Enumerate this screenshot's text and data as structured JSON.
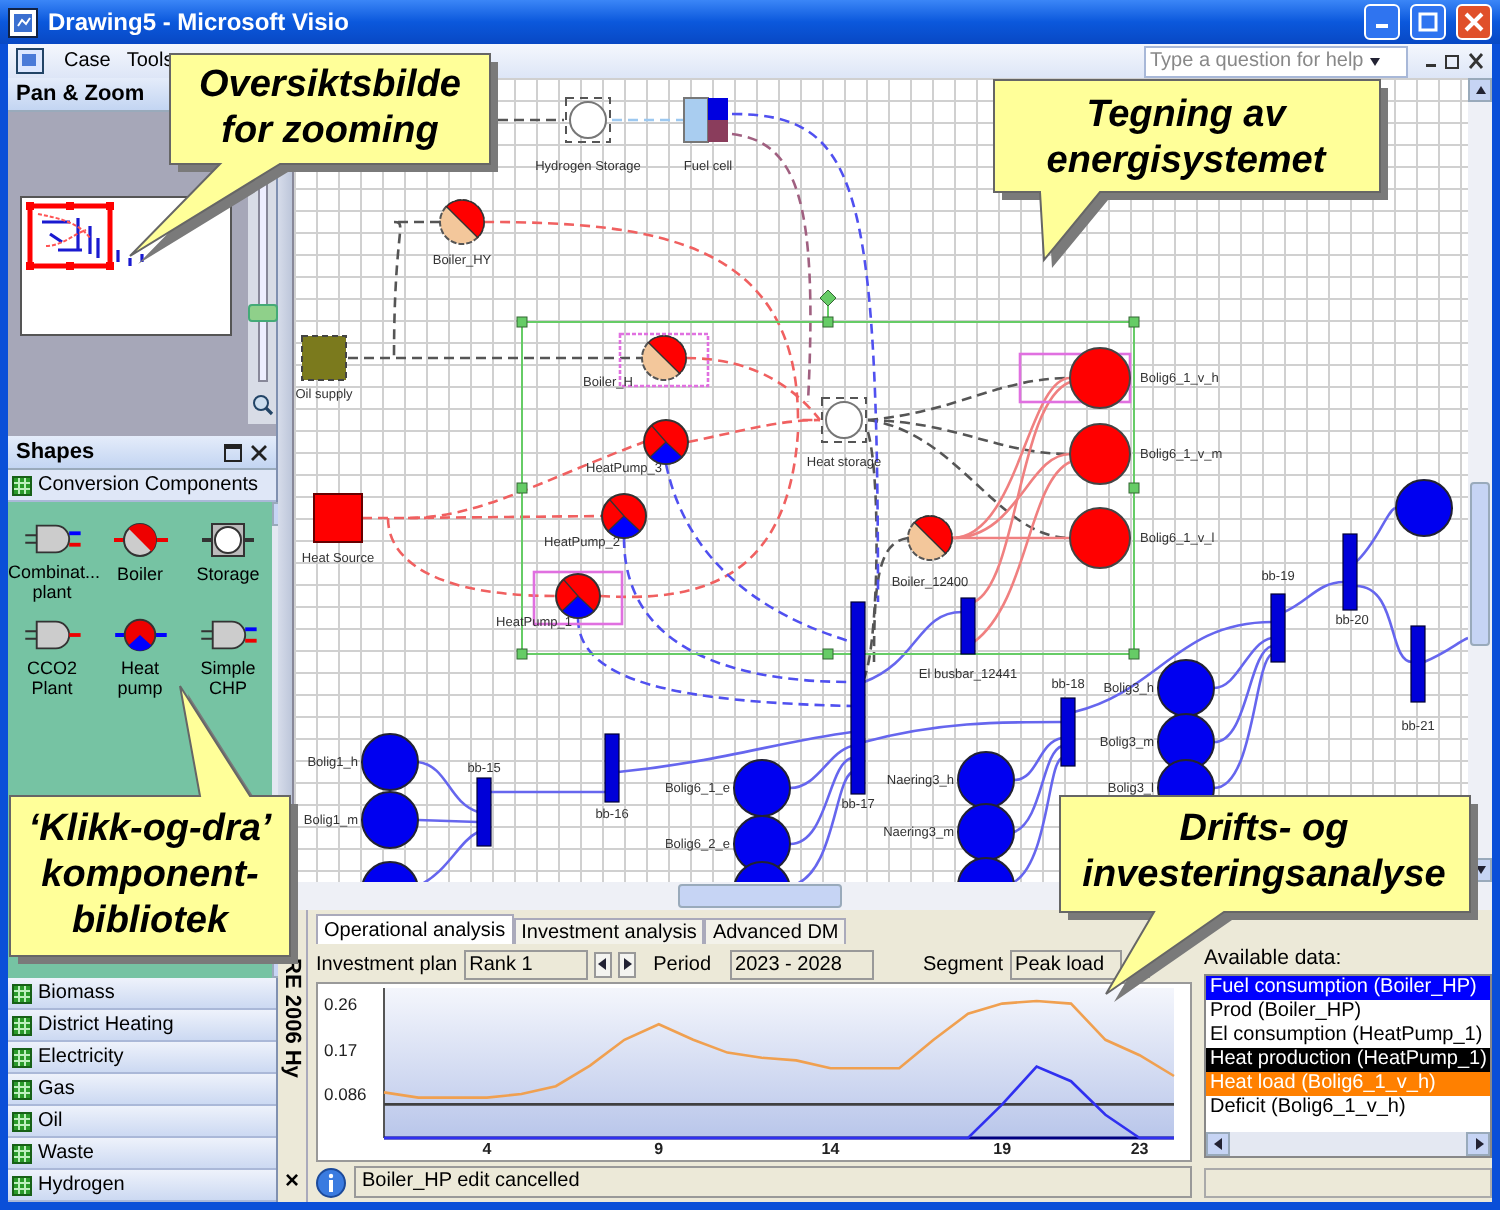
{
  "window": {
    "title": "Drawing5 - Microsoft Visio"
  },
  "menu": {
    "items": [
      "Case",
      "Tools"
    ],
    "help_search": {
      "placeholder": "Type a question for help"
    }
  },
  "pan_zoom": {
    "title": "Pan & Zoom",
    "zoom": {
      "level": 0.27
    }
  },
  "shapes": {
    "title": "Shapes",
    "stencils": [
      {
        "label": "Conversion Components",
        "expanded": true,
        "shapes": [
          {
            "label": "Combinat... plant",
            "kind": "chp"
          },
          {
            "label": "Boiler",
            "kind": "boiler"
          },
          {
            "label": "Storage",
            "kind": "storage"
          },
          {
            "label": "CCO2 Plant",
            "kind": "cco2"
          },
          {
            "label": "Heat pump",
            "kind": "heat-pump"
          },
          {
            "label": "Simple CHP",
            "kind": "chp"
          }
        ]
      },
      {
        "label": "Biomass",
        "expanded": false
      },
      {
        "label": "District Heating",
        "expanded": false
      },
      {
        "label": "Electricity",
        "expanded": false
      },
      {
        "label": "Gas",
        "expanded": false
      },
      {
        "label": "Oil",
        "expanded": false
      },
      {
        "label": "Waste",
        "expanded": false
      },
      {
        "label": "Hydrogen",
        "expanded": false
      }
    ]
  },
  "side_strip": {
    "label": "RE 2006 Hy",
    "close": "×"
  },
  "diagram": {
    "nodes": [
      {
        "label": "Hydrogen Storage",
        "kind": "storage",
        "highlighted": false
      },
      {
        "label": "Fuel cell",
        "kind": "fuel-cell",
        "highlighted": false
      },
      {
        "label": "Boiler_HY",
        "kind": "boiler",
        "highlighted": false
      },
      {
        "label": "Oil supply",
        "kind": "oil-supply",
        "highlighted": false
      },
      {
        "label": "Boiler_H",
        "kind": "boiler",
        "highlighted": true
      },
      {
        "label": "Heat storage",
        "kind": "storage",
        "highlighted": false
      },
      {
        "label": "HeatPump_3",
        "kind": "heat-pump",
        "highlighted": false
      },
      {
        "label": "HeatPump_2",
        "kind": "heat-pump",
        "highlighted": false
      },
      {
        "label": "Heat Source",
        "kind": "heat-source",
        "highlighted": false
      },
      {
        "label": "HeatPump_1",
        "kind": "heat-pump",
        "highlighted": true
      },
      {
        "label": "Bolig6_1_v_h",
        "kind": "heat-demand",
        "highlighted": true
      },
      {
        "label": "Bolig6_1_v_m",
        "kind": "heat-demand",
        "highlighted": false
      },
      {
        "label": "Bolig6_1_v_l",
        "kind": "heat-demand",
        "highlighted": false
      },
      {
        "label": "Boiler_12400",
        "kind": "boiler",
        "highlighted": false
      },
      {
        "label": "El busbar_12441",
        "kind": "busbar",
        "highlighted": false
      },
      {
        "label": "bb-17",
        "kind": "busbar",
        "highlighted": false
      },
      {
        "label": "bb-19",
        "kind": "busbar",
        "highlighted": false
      },
      {
        "label": "bb-20",
        "kind": "busbar",
        "highlighted": false
      },
      {
        "label": "bb-21",
        "kind": "busbar",
        "highlighted": false
      },
      {
        "label": "bb-18",
        "kind": "busbar",
        "highlighted": false
      },
      {
        "label": "bb-15",
        "kind": "busbar",
        "highlighted": false
      },
      {
        "label": "bb-16",
        "kind": "busbar",
        "highlighted": false
      },
      {
        "label": "Bolig1_h",
        "kind": "el-demand",
        "highlighted": false
      },
      {
        "label": "Bolig1_m",
        "kind": "el-demand",
        "highlighted": false
      },
      {
        "kind": "el-demand",
        "highlighted": false
      },
      {
        "label": "Bolig6_1_e",
        "kind": "el-demand",
        "highlighted": false
      },
      {
        "label": "Bolig6_2_e",
        "kind": "el-demand",
        "highlighted": false
      },
      {
        "kind": "el-demand",
        "highlighted": false
      },
      {
        "label": "Naering3_h",
        "kind": "el-demand",
        "highlighted": false
      },
      {
        "label": "Naering3_m",
        "kind": "el-demand",
        "highlighted": false
      },
      {
        "kind": "el-demand",
        "highlighted": false
      },
      {
        "label": "Bolig3_h",
        "kind": "el-demand",
        "highlighted": false
      },
      {
        "label": "Bolig3_m",
        "kind": "el-demand",
        "highlighted": false
      },
      {
        "label": "Bolig3_l",
        "kind": "el-demand",
        "highlighted": false
      },
      {
        "kind": "el-demand",
        "highlighted": false
      }
    ]
  },
  "analysis": {
    "tabs": [
      {
        "label": "Operational analysis",
        "selected": true
      },
      {
        "label": "Investment analysis",
        "selected": false
      },
      {
        "label": "Advanced DM",
        "selected": false
      }
    ],
    "investment_plan": {
      "label": "Investment plan",
      "value": "Rank 1"
    },
    "period": {
      "label": "Period",
      "value": "2023 - 2028"
    },
    "segment": {
      "label": "Segment",
      "value": "Peak load"
    },
    "chart_data": {
      "type": "line",
      "x": [
        1,
        2,
        3,
        4,
        5,
        6,
        7,
        8,
        9,
        10,
        11,
        12,
        13,
        14,
        15,
        16,
        17,
        18,
        19,
        20,
        21,
        22,
        23,
        24
      ],
      "xlim": [
        1,
        24
      ],
      "ylim": [
        0,
        0.29
      ],
      "xticks": [
        4,
        9,
        14,
        19,
        23
      ],
      "yticks": [
        0.086,
        0.17,
        0.26
      ],
      "series": [
        {
          "color": "#f0a050",
          "values": [
            0.088,
            0.078,
            0.078,
            0.078,
            0.085,
            0.1,
            0.14,
            0.19,
            0.22,
            0.19,
            0.165,
            0.155,
            0.15,
            0.135,
            0.135,
            0.135,
            0.19,
            0.24,
            0.26,
            0.265,
            0.26,
            0.19,
            0.16,
            0.12
          ]
        },
        {
          "color": "#404040",
          "values": [
            0.065,
            0.065,
            0.065,
            0.065,
            0.065,
            0.065,
            0.065,
            0.065,
            0.065,
            0.065,
            0.065,
            0.065,
            0.065,
            0.065,
            0.065,
            0.065,
            0.065,
            0.065,
            0.065,
            0.065,
            0.065,
            0.065,
            0.065,
            0.065
          ]
        },
        {
          "color": "#3030f0",
          "values": [
            0,
            0,
            0,
            0,
            0,
            0,
            0,
            0,
            0,
            0,
            0,
            0,
            0,
            0,
            0,
            0,
            0,
            0,
            0.065,
            0.138,
            0.11,
            0.045,
            0,
            0
          ]
        }
      ]
    },
    "status": "Boiler_HP edit cancelled",
    "available_data": {
      "label": "Available data:",
      "items": [
        {
          "label": "Fuel consumption (Boiler_HP)",
          "color": "#0000ff"
        },
        {
          "label": "Prod (Boiler_HP)"
        },
        {
          "label": "El consumption (HeatPump_1)"
        },
        {
          "label": "Heat production (HeatPump_1)",
          "color": "#000000"
        },
        {
          "label": "Heat load (Bolig6_1_v_h)",
          "color": "#ff8000"
        },
        {
          "label": "Deficit (Bolig6_1_v_h)"
        }
      ]
    }
  },
  "callouts": [
    {
      "lines": [
        "Oversiktsbilde",
        "for zooming"
      ]
    },
    {
      "lines": [
        "Tegning av",
        "energisystemet"
      ]
    },
    {
      "lines": [
        "‘Klikk-og-dra’",
        "komponent-",
        "bibliotek"
      ]
    },
    {
      "lines": [
        "Drifts- og",
        "investeringsanalyse"
      ]
    }
  ]
}
